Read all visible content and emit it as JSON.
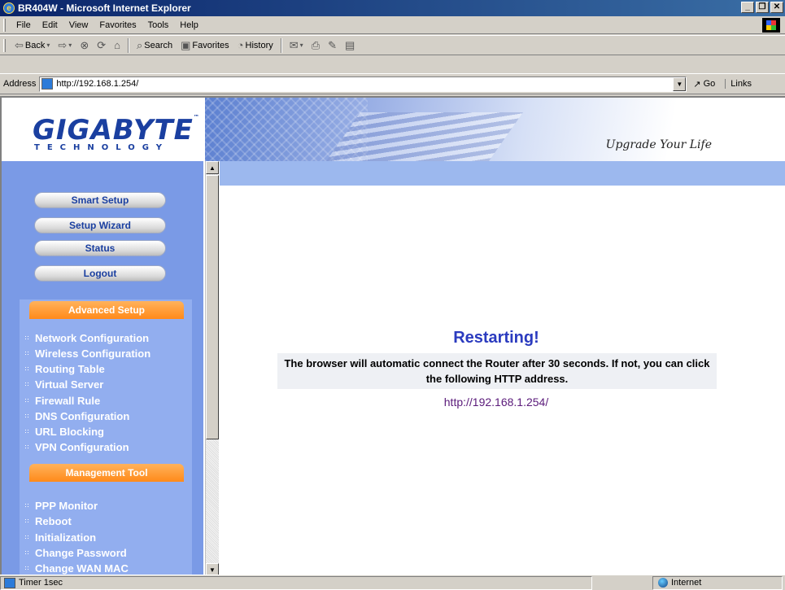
{
  "window": {
    "title": "BR404W - Microsoft Internet Explorer"
  },
  "menu": [
    "File",
    "Edit",
    "View",
    "Favorites",
    "Tools",
    "Help"
  ],
  "toolbar": {
    "back": "Back",
    "search": "Search",
    "favorites": "Favorites",
    "history": "History"
  },
  "address": {
    "label": "Address",
    "url": "http://192.168.1.254/",
    "go": "Go",
    "links": "Links"
  },
  "banner": {
    "logo": "GIGABYTE",
    "logo_sub": "TECHNOLOGY",
    "tagline": "Upgrade Your Life"
  },
  "sidebar": {
    "buttons": [
      "Smart Setup",
      "Setup Wizard",
      "Status",
      "Logout"
    ],
    "advanced_title": "Advanced Setup",
    "advanced_links": [
      "Network Configuration",
      "Wireless Configuration",
      "Routing Table",
      "Virtual Server",
      "Firewall Rule",
      "DNS Configuration",
      "URL Blocking",
      "VPN Configuration"
    ],
    "management_title": "Management Tool",
    "management_links": [
      "PPP Monitor",
      "Reboot",
      "Initialization",
      "Change Password",
      "Change WAN MAC"
    ]
  },
  "content": {
    "title": "Restarting!",
    "message": "The browser will automatic connect the Router after 30 seconds.  If not, you can click the following HTTP address.",
    "link": "http://192.168.1.254/"
  },
  "status": {
    "text": "Timer 1sec",
    "zone": "Internet"
  }
}
